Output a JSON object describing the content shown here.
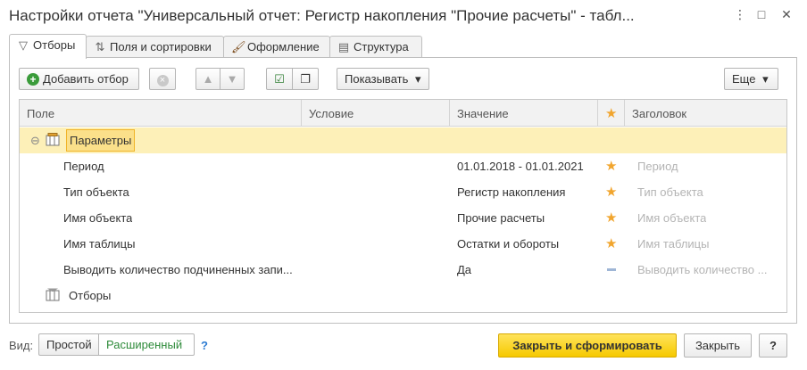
{
  "window": {
    "title": "Настройки отчета \"Универсальный отчет: Регистр накопления \"Прочие расчеты\" - табл...",
    "more_glyph": "⋮",
    "maximize_glyph": "□",
    "close_glyph": "✕"
  },
  "tabs": [
    {
      "label": "Отборы",
      "icon": "filter-icon",
      "glyph": "▽",
      "active": true
    },
    {
      "label": "Поля и сортировки",
      "icon": "fields-sort-icon",
      "glyph": "⇅"
    },
    {
      "label": "Оформление",
      "icon": "brush-icon",
      "glyph": "🖌"
    },
    {
      "label": "Структура",
      "icon": "structure-icon",
      "glyph": "▤"
    }
  ],
  "toolbar": {
    "add_filter_label": "Добавить отбор",
    "add_glyph": "+",
    "delete_glyph": "×",
    "up_glyph": "▲",
    "down_glyph": "▼",
    "check_all_glyph": "☑",
    "copy_glyph": "❐",
    "show_label": "Показывать",
    "more_label": "Еще",
    "dropdown_glyph": "▾"
  },
  "grid": {
    "columns": {
      "field": "Поле",
      "condition": "Условие",
      "value": "Значение",
      "star": "★",
      "caption": "Заголовок"
    },
    "group": {
      "collapse_glyph": "⊖",
      "label": "Параметры"
    },
    "rows": [
      {
        "field": "Период",
        "value": "01.01.2018 - 01.01.2021",
        "mark": "★",
        "caption": "Период"
      },
      {
        "field": "Тип объекта",
        "value": "Регистр накопления",
        "mark": "★",
        "caption": "Тип объекта"
      },
      {
        "field": "Имя объекта",
        "value": "Прочие расчеты",
        "mark": "★",
        "caption": "Имя объекта"
      },
      {
        "field": "Имя таблицы",
        "value": "Остатки и обороты",
        "mark": "★",
        "caption": "Имя таблицы"
      },
      {
        "field": "Выводить количество подчиненных запи...",
        "value": "Да",
        "mark": "",
        "caption": "Выводить количество ..."
      }
    ],
    "filters_label": "Отборы"
  },
  "footer": {
    "view_label": "Вид:",
    "simple_label": "Простой",
    "extended_label": "Расширенный",
    "help_label": "?",
    "generate_label": "Закрыть и сформировать",
    "close_label": "Закрыть",
    "question_label": "?"
  },
  "colors": {
    "accent_yellow": "#f6c900",
    "group_row": "#fdf0b8",
    "star": "#f1a52e",
    "link_green": "#2e8b3a"
  }
}
